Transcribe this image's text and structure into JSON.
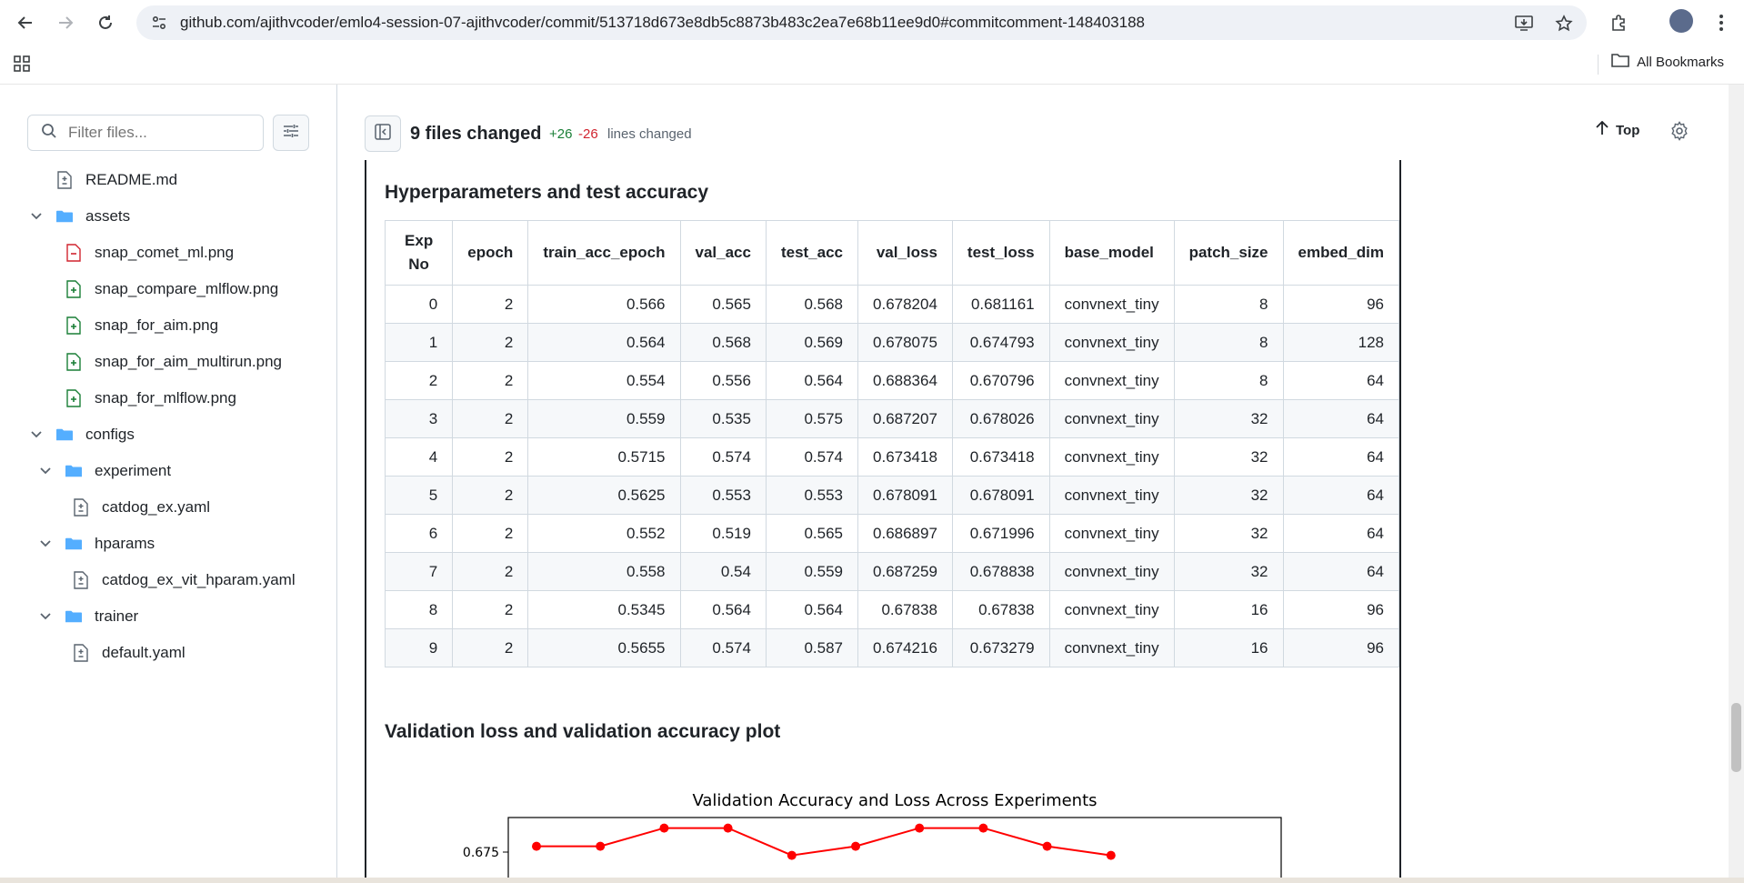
{
  "browser": {
    "url": "github.com/ajithvcoder/emlo4-session-07-ajithvcoder/commit/513718d673e8db5c8873b483c2ea7e68b11ee9d0#commitcomment-148403188",
    "bookmarks_label": "All Bookmarks"
  },
  "sidebar": {
    "filter_placeholder": "Filter files...",
    "items": [
      {
        "label": "README.md",
        "type": "file",
        "status": "modified"
      },
      {
        "label": "assets",
        "type": "folder"
      },
      {
        "label": "snap_comet_ml.png",
        "type": "file",
        "status": "removed"
      },
      {
        "label": "snap_compare_mlflow.png",
        "type": "file",
        "status": "added"
      },
      {
        "label": "snap_for_aim.png",
        "type": "file",
        "status": "added"
      },
      {
        "label": "snap_for_aim_multirun.png",
        "type": "file",
        "status": "added"
      },
      {
        "label": "snap_for_mlflow.png",
        "type": "file",
        "status": "added"
      },
      {
        "label": "configs",
        "type": "folder"
      },
      {
        "label": "experiment",
        "type": "folder"
      },
      {
        "label": "catdog_ex.yaml",
        "type": "file",
        "status": "modified"
      },
      {
        "label": "hparams",
        "type": "folder"
      },
      {
        "label": "catdog_ex_vit_hparam.yaml",
        "type": "file",
        "status": "modified"
      },
      {
        "label": "trainer",
        "type": "folder"
      },
      {
        "label": "default.yaml",
        "type": "file",
        "status": "modified"
      }
    ]
  },
  "header": {
    "files_changed": "9 files changed",
    "additions": "+26",
    "deletions": "-26",
    "lines_changed": "lines changed",
    "top_label": "Top"
  },
  "content": {
    "section1_title": "Hyperparameters and test accuracy",
    "section2_title": "Validation loss and validation accuracy plot",
    "table": {
      "headers": [
        "Exp No",
        "epoch",
        "train_acc_epoch",
        "val_acc",
        "test_acc",
        "val_loss",
        "test_loss",
        "base_model",
        "patch_size",
        "embed_dim"
      ],
      "rows": [
        [
          "0",
          "2",
          "0.566",
          "0.565",
          "0.568",
          "0.678204",
          "0.681161",
          "convnext_tiny",
          "8",
          "96"
        ],
        [
          "1",
          "2",
          "0.564",
          "0.568",
          "0.569",
          "0.678075",
          "0.674793",
          "convnext_tiny",
          "8",
          "128"
        ],
        [
          "2",
          "2",
          "0.554",
          "0.556",
          "0.564",
          "0.688364",
          "0.670796",
          "convnext_tiny",
          "8",
          "64"
        ],
        [
          "3",
          "2",
          "0.559",
          "0.535",
          "0.575",
          "0.687207",
          "0.678026",
          "convnext_tiny",
          "32",
          "64"
        ],
        [
          "4",
          "2",
          "0.5715",
          "0.574",
          "0.574",
          "0.673418",
          "0.673418",
          "convnext_tiny",
          "32",
          "64"
        ],
        [
          "5",
          "2",
          "0.5625",
          "0.553",
          "0.553",
          "0.678091",
          "0.678091",
          "convnext_tiny",
          "32",
          "64"
        ],
        [
          "6",
          "2",
          "0.552",
          "0.519",
          "0.565",
          "0.686897",
          "0.671996",
          "convnext_tiny",
          "32",
          "64"
        ],
        [
          "7",
          "2",
          "0.558",
          "0.54",
          "0.559",
          "0.687259",
          "0.678838",
          "convnext_tiny",
          "32",
          "64"
        ],
        [
          "8",
          "2",
          "0.5345",
          "0.564",
          "0.564",
          "0.67838",
          "0.67838",
          "convnext_tiny",
          "16",
          "96"
        ],
        [
          "9",
          "2",
          "0.5655",
          "0.574",
          "0.587",
          "0.674216",
          "0.673279",
          "convnext_tiny",
          "16",
          "96"
        ]
      ]
    }
  },
  "chart_data": {
    "type": "line",
    "title": "Validation Accuracy and Loss Across Experiments",
    "ytick_labels": [
      "0.675"
    ],
    "series": [
      {
        "color": "#ff0000",
        "values": [
          0.6782,
          0.6782,
          0.6882,
          0.6882,
          0.6732,
          0.6782,
          0.6882,
          0.6882,
          0.6782,
          0.6732
        ]
      }
    ]
  },
  "colors": {
    "added": "#1a7f37",
    "removed": "#d1242f",
    "folder": "#54aeff",
    "series": "#ff0000"
  }
}
